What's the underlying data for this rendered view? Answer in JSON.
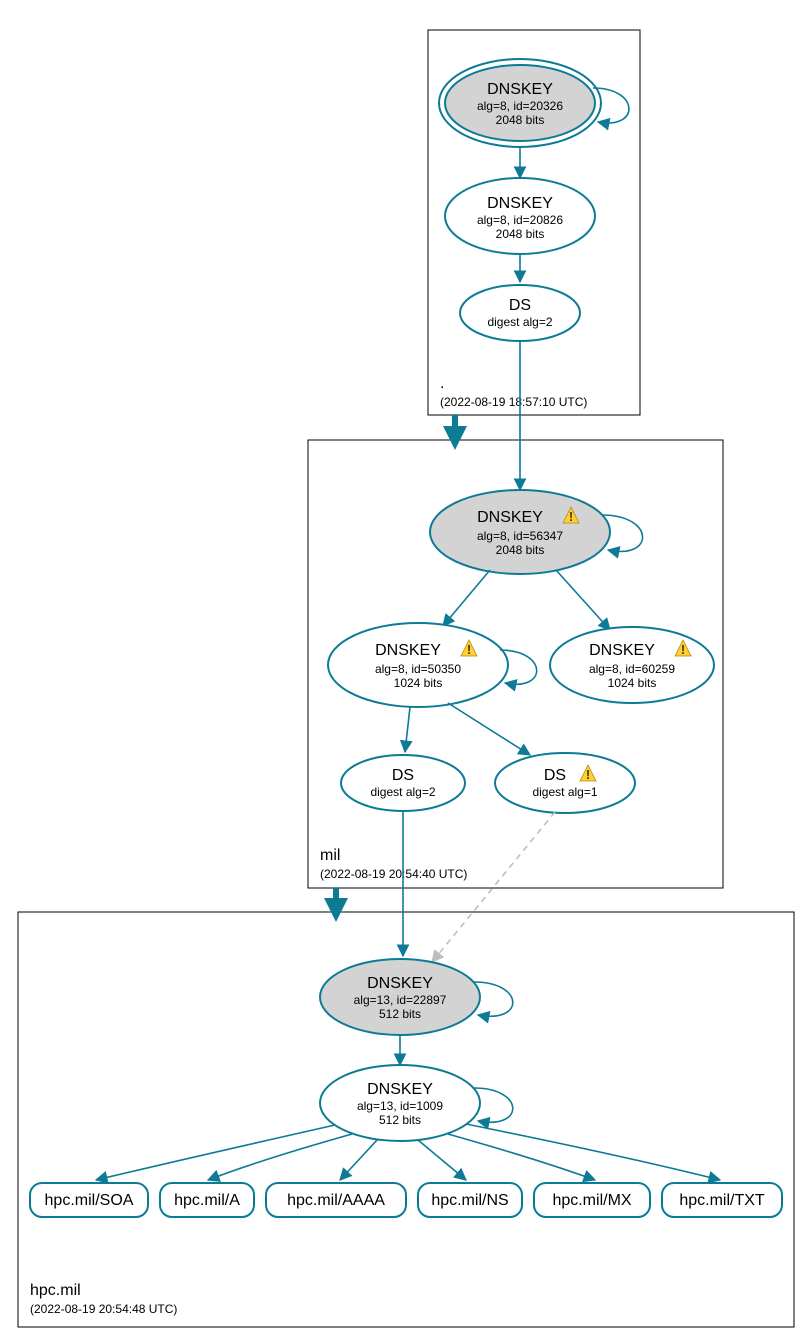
{
  "zones": {
    "root": {
      "name": ".",
      "timestamp": "(2022-08-19 18:57:10 UTC)"
    },
    "mil": {
      "name": "mil",
      "timestamp": "(2022-08-19 20:54:40 UTC)"
    },
    "hpc": {
      "name": "hpc.mil",
      "timestamp": "(2022-08-19 20:54:48 UTC)"
    }
  },
  "nodes": {
    "root_ksk": {
      "title": "DNSKEY",
      "line2": "alg=8, id=20326",
      "line3": "2048 bits"
    },
    "root_zsk": {
      "title": "DNSKEY",
      "line2": "alg=8, id=20826",
      "line3": "2048 bits"
    },
    "root_ds": {
      "title": "DS",
      "line2": "digest alg=2"
    },
    "mil_ksk": {
      "title": "DNSKEY",
      "line2": "alg=8, id=56347",
      "line3": "2048 bits"
    },
    "mil_zsk1": {
      "title": "DNSKEY",
      "line2": "alg=8, id=50350",
      "line3": "1024 bits"
    },
    "mil_zsk2": {
      "title": "DNSKEY",
      "line2": "alg=8, id=60259",
      "line3": "1024 bits"
    },
    "mil_ds2": {
      "title": "DS",
      "line2": "digest alg=2"
    },
    "mil_ds1": {
      "title": "DS",
      "line2": "digest alg=1"
    },
    "hpc_ksk": {
      "title": "DNSKEY",
      "line2": "alg=13, id=22897",
      "line3": "512 bits"
    },
    "hpc_zsk": {
      "title": "DNSKEY",
      "line2": "alg=13, id=1009",
      "line3": "512 bits"
    },
    "rr_soa": {
      "label": "hpc.mil/SOA"
    },
    "rr_a": {
      "label": "hpc.mil/A"
    },
    "rr_aaaa": {
      "label": "hpc.mil/AAAA"
    },
    "rr_ns": {
      "label": "hpc.mil/NS"
    },
    "rr_mx": {
      "label": "hpc.mil/MX"
    },
    "rr_txt": {
      "label": "hpc.mil/TXT"
    }
  },
  "colors": {
    "teal": "#0d7a96",
    "node_fill": "#d3d3d3"
  }
}
